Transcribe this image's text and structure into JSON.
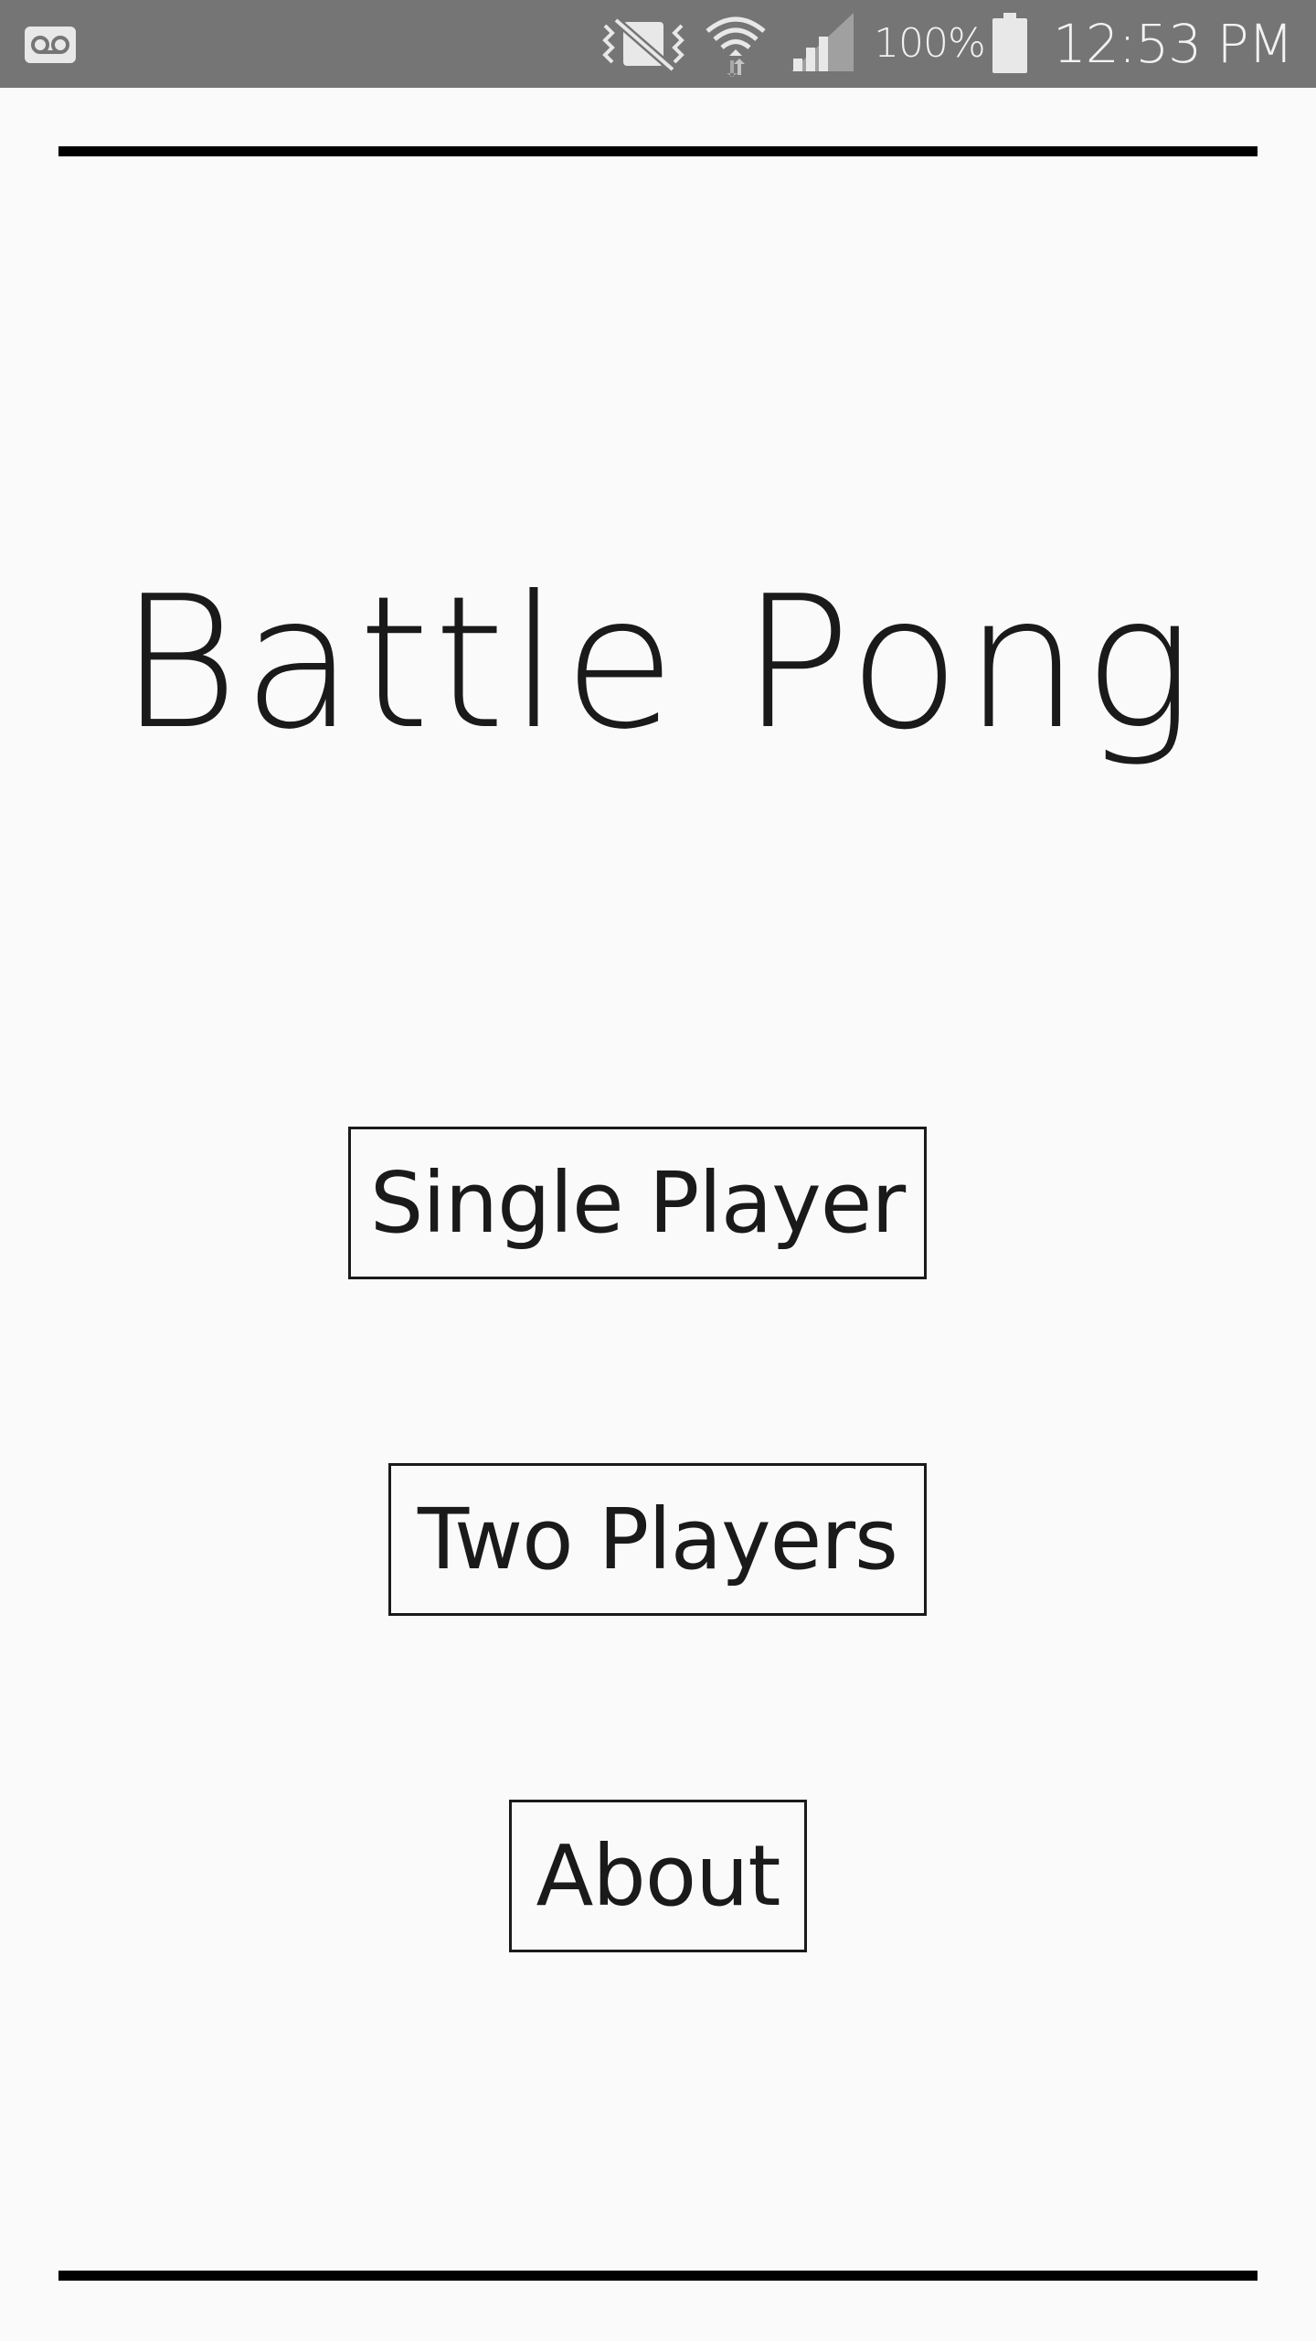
{
  "status_bar": {
    "battery_percent": "100%",
    "time": "12:53 PM",
    "icons": [
      "voicemail-icon",
      "vibrate-icon",
      "wifi-icon",
      "cell-signal-icon",
      "battery-icon"
    ]
  },
  "app": {
    "title": "Battle Pong"
  },
  "menu": {
    "single_player_label": "Single Player",
    "two_players_label": "Two Players",
    "about_label": "About"
  },
  "colors": {
    "background": "#fafafa",
    "status_bar": "#757575",
    "ink": "#1a1a1a"
  }
}
